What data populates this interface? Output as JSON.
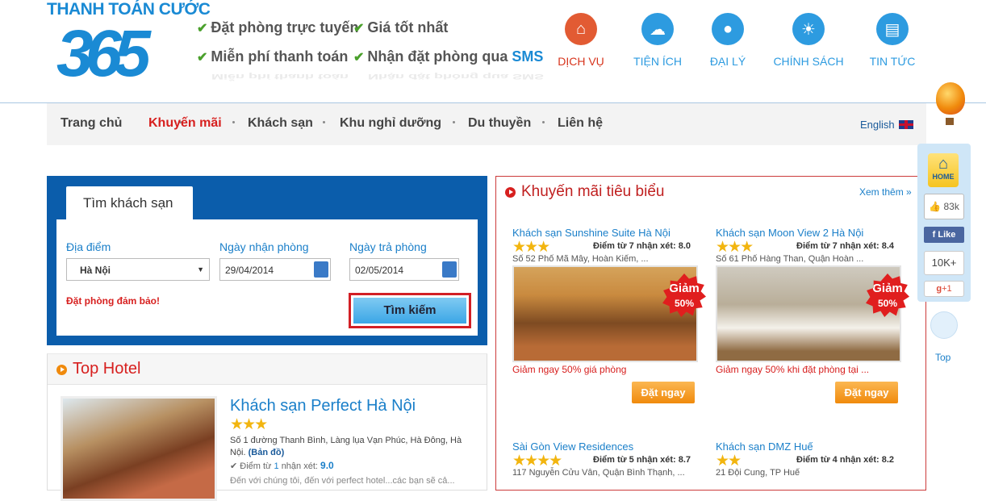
{
  "header": {
    "logo_line1": "THANH TOÁN CƯỚC",
    "logo_line2": "365",
    "features": [
      "Đặt phòng trực tuyến",
      "Giá tốt nhất",
      "Miễn phí thanh toán",
      "Nhận đặt phòng qua ",
      "SMS"
    ],
    "nav_icons": [
      {
        "label": "DỊCH VỤ",
        "icon": "basket-icon"
      },
      {
        "label": "TIỆN ÍCH",
        "icon": "cloud-icon"
      },
      {
        "label": "ĐẠI LÝ",
        "icon": "user-icon"
      },
      {
        "label": "CHÍNH SÁCH",
        "icon": "lightbulb-icon"
      },
      {
        "label": "TIN TỨC",
        "icon": "document-icon"
      }
    ]
  },
  "menu": {
    "items": [
      "Trang chủ",
      "Khuyến mãi",
      "Khách sạn",
      "Khu nghỉ dưỡng",
      "Du thuyền",
      "Liên hệ"
    ],
    "active": "Khuyến mãi",
    "language": "English"
  },
  "search": {
    "tab": "Tìm khách sạn",
    "location_label": "Địa điểm",
    "location_value": "Hà Nội",
    "checkin_label": "Ngày nhận phòng",
    "checkin_value": "29/04/2014",
    "checkout_label": "Ngày trả phòng",
    "checkout_value": "02/05/2014",
    "guarantee": "Đặt phòng đảm bảo!",
    "button": "Tìm kiếm"
  },
  "top_hotel": {
    "title": "Top Hotel",
    "name": "Khách sạn Perfect Hà Nội",
    "stars": 3,
    "address": "Số 1 đường Thanh Bình, Làng lụa Vạn Phúc, Hà Đông, Hà Nội.",
    "map_link": "(Bản đồ)",
    "score_prefix": "Điểm từ",
    "score_count": "1",
    "score_suffix": "nhận xét:",
    "score": "9.0",
    "desc": "Đến với chúng tôi, đến với perfect hotel...các bạn sẽ cả..."
  },
  "promo": {
    "title": "Khuyến mãi tiêu biểu",
    "see_more": "Xem thêm",
    "cards": [
      {
        "name": "Khách sạn Sunshine Suite Hà Nội",
        "stars": "★★★",
        "score_text": "Điểm từ 7 nhận xét: 8.0",
        "address": "Số 52 Phố Mã Mây, Hoàn Kiếm, ...",
        "badge_top": "Giảm",
        "badge_bottom": "50%",
        "deal": "Giảm ngay 50% giá phòng",
        "book": "Đặt ngay"
      },
      {
        "name": "Khách sạn Moon View 2 Hà Nội",
        "stars": "★★★",
        "score_text": "Điểm từ 7 nhận xét: 8.4",
        "address": "Số 61 Phố Hàng Than, Quận Hoàn ...",
        "badge_top": "Giảm",
        "badge_bottom": "50%",
        "deal": "Giảm ngay 50% khi đặt phòng tại ...",
        "book": "Đặt ngay"
      },
      {
        "name": "Sài Gòn View Residences",
        "stars": "★★★★",
        "score_text": "Điểm từ 5 nhận xét: 8.7",
        "address": "117 Nguyễn Cửu Vân, Quận Bình Thạnh, ..."
      },
      {
        "name": "Khách sạn DMZ Huế",
        "stars": "★★",
        "score_text": "Điểm từ 4 nhận xét: 8.2",
        "address": "21 Đội Cung, TP Huế"
      }
    ]
  },
  "social": {
    "home": "HOME",
    "likes": "83k",
    "like_button": "Like",
    "followers": "10K+",
    "gplus": "+1",
    "top": "Top"
  }
}
